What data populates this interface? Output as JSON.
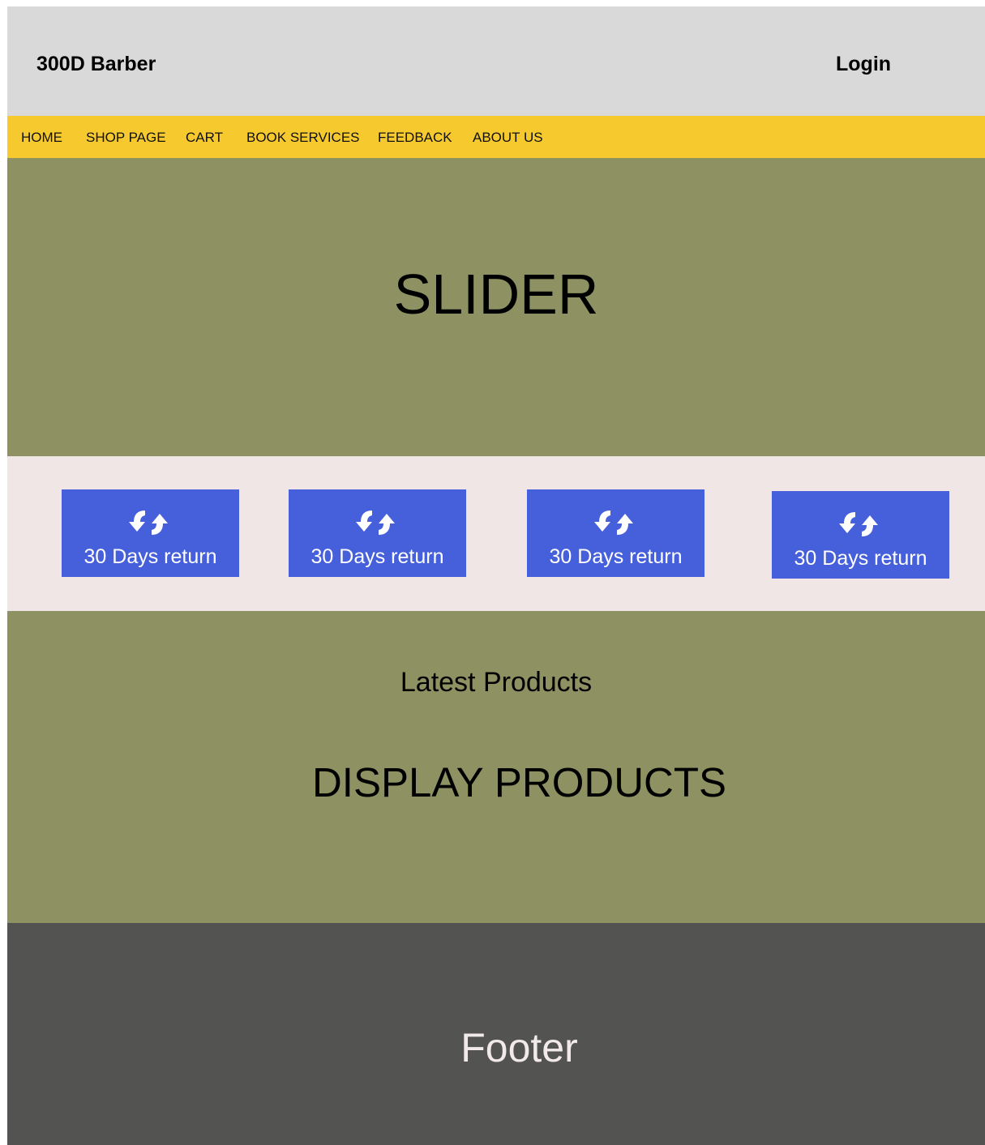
{
  "header": {
    "brand": "300D Barber",
    "login_label": "Login"
  },
  "nav": {
    "items": [
      {
        "label": "HOME"
      },
      {
        "label": "SHOP PAGE"
      },
      {
        "label": "CART"
      },
      {
        "label": "BOOK SERVICES"
      },
      {
        "label": "FEEDBACK"
      },
      {
        "label": "ABOUT US"
      }
    ]
  },
  "slider": {
    "title": "SLIDER"
  },
  "features": {
    "items": [
      {
        "icon": "refresh-arrows-icon",
        "label": "30 Days return"
      },
      {
        "icon": "refresh-arrows-icon",
        "label": "30 Days return"
      },
      {
        "icon": "refresh-arrows-icon",
        "label": "30 Days return"
      },
      {
        "icon": "refresh-arrows-icon",
        "label": "30 Days return"
      }
    ]
  },
  "products": {
    "heading": "Latest Products",
    "display": "DISPLAY PRODUCTS"
  },
  "footer": {
    "text": "Footer"
  },
  "colors": {
    "header_bg": "#d9d9d9",
    "nav_bg": "#f6ca2f",
    "olive_bg": "#8e9262",
    "features_bg": "#f0e6e6",
    "feature_card": "#465fdb",
    "footer_bg": "#535352"
  }
}
